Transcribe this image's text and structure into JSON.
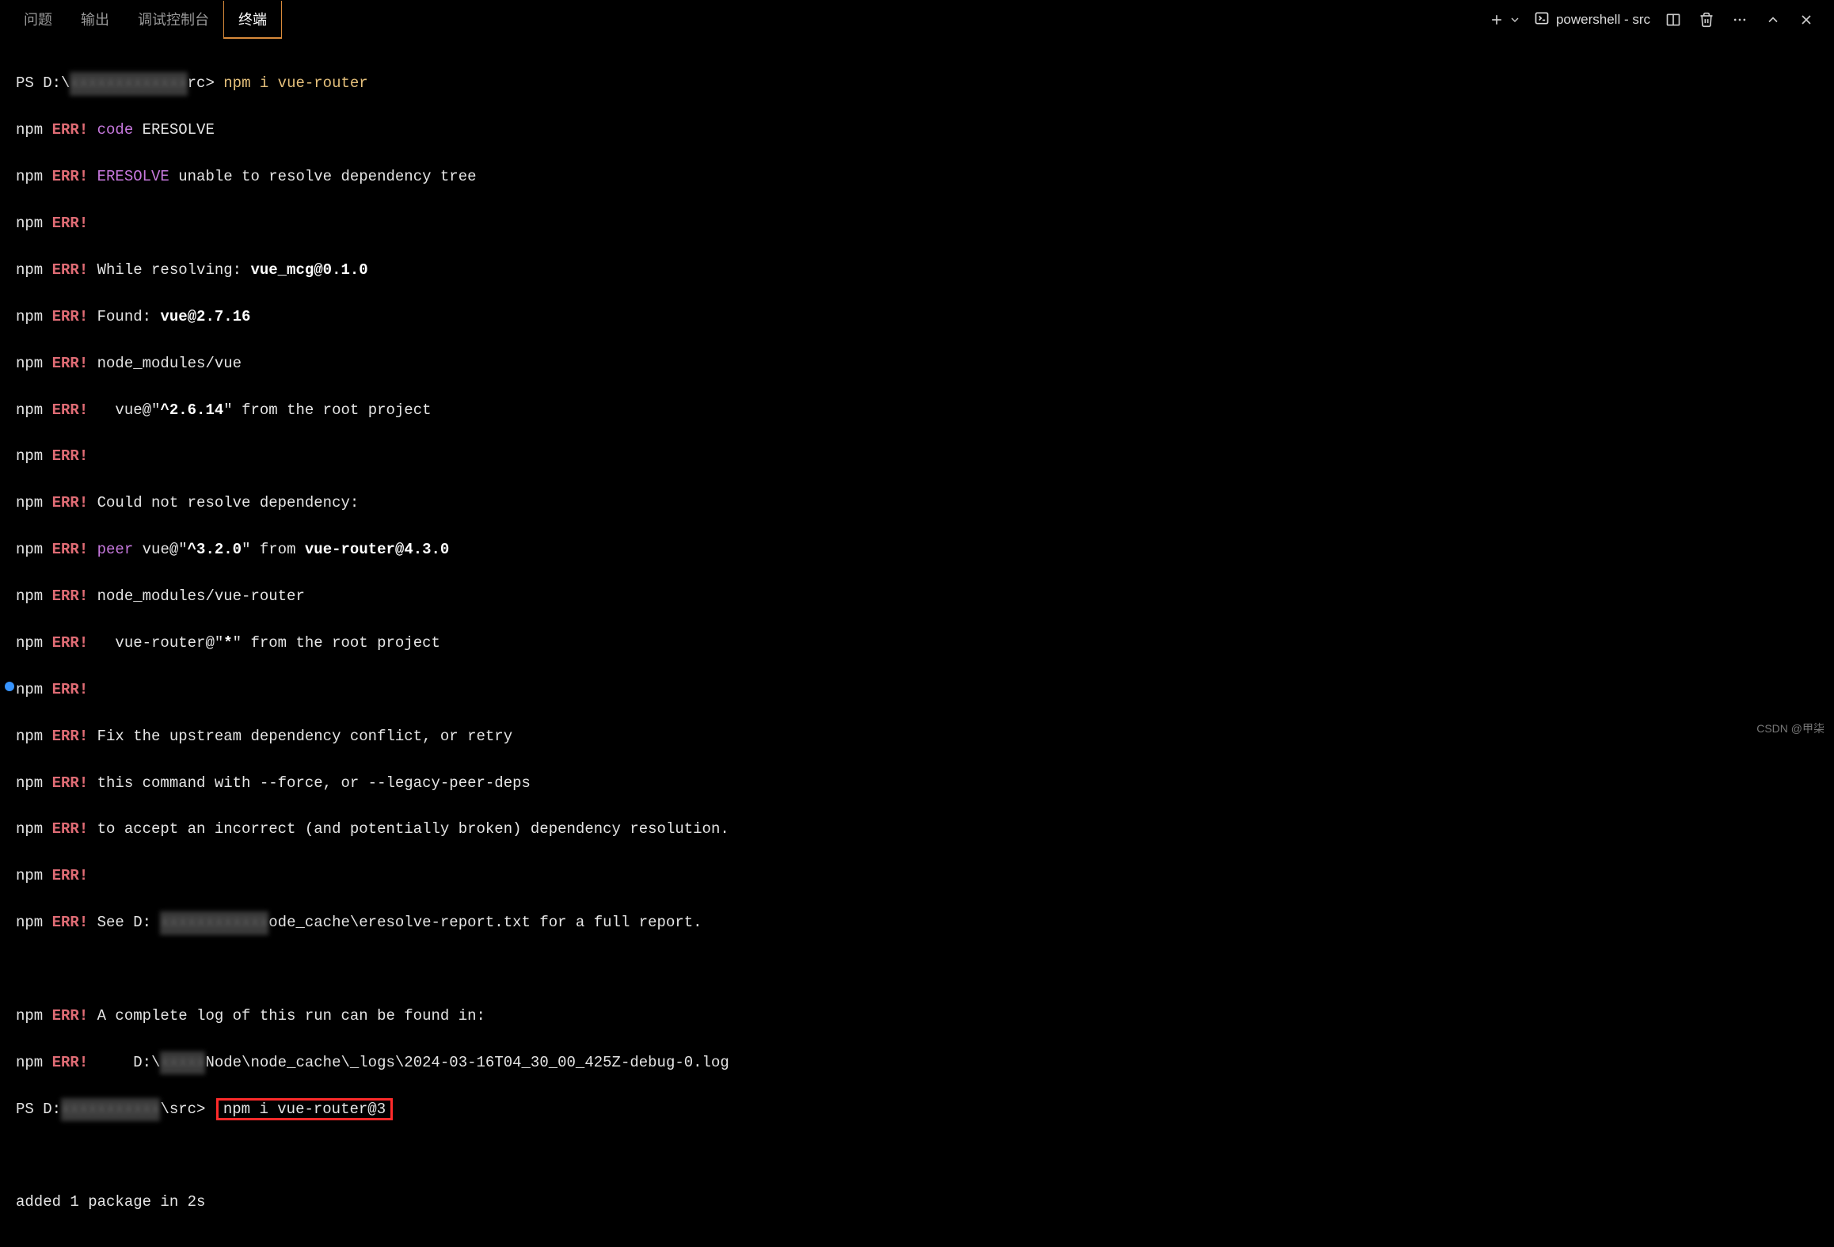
{
  "tabs": {
    "problems": "问题",
    "output": "输出",
    "debug_console": "调试控制台",
    "terminal": "终端"
  },
  "toolbar": {
    "shell_label": "powershell - src"
  },
  "terminal": {
    "prompt1_pre": "PS D:\\",
    "prompt1_post": "rc> ",
    "cmd1": "npm i vue-router",
    "l1_npm": "npm ",
    "l1_err": "ERR!",
    "l1_code": " code",
    "l1_rest": " ERESOLVE",
    "l2_eresolve": " ERESOLVE",
    "l2_rest": " unable to resolve dependency tree",
    "l4_text": " While resolving: ",
    "l4_bold": "vue_mcg@0.1.0",
    "l5_text": " Found: ",
    "l5_bold": "vue@2.7.16",
    "l6_text": " node_modules/vue",
    "l7_pre": "   vue@\"",
    "l7_bold": "^2.6.14",
    "l7_post": "\" from the root project",
    "l9_text": " Could not resolve dependency:",
    "l10_peer": " peer",
    "l10_pre": " vue@\"",
    "l10_bold": "^3.2.0",
    "l10_mid": "\" from ",
    "l10_bold2": "vue-router@4.3.0",
    "l11_text": " node_modules/vue-router",
    "l12_pre": "   vue-router@\"",
    "l12_bold": "*",
    "l12_post": "\" from the root project",
    "l14_text": " Fix the upstream dependency conflict, or retry",
    "l15_text": " this command with --force, or --legacy-peer-deps",
    "l16_text": " to accept an incorrect (and potentially broken) dependency resolution.",
    "l18_pre": " See D: ",
    "l18_post": "ode_cache\\eresolve-report.txt for a full report.",
    "l20_text": " A complete log of this run can be found in:",
    "l21_pre": "     D:\\",
    "l21_post": "Node\\node_cache\\_logs\\2024-03-16T04_30_00_425Z-debug-0.log",
    "prompt2_pre": "PS D:",
    "prompt2_post": "\\src> ",
    "cmd2": "npm i vue-router@3",
    "added": "added 1 package in 2s"
  },
  "watermark": "CSDN @甲柒"
}
